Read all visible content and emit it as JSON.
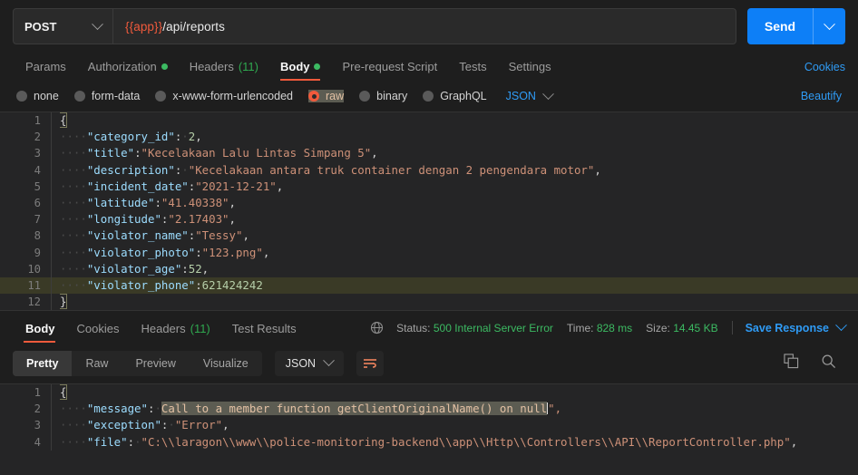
{
  "request": {
    "method": "POST",
    "method_icon": "chevron-down-icon",
    "url_variable": "{{app}}",
    "url_path": "/api/reports",
    "send_label": "Send",
    "send_caret_icon": "chevron-down-icon",
    "tabs": [
      {
        "label": "Params",
        "badge": "",
        "dot": false,
        "active": false
      },
      {
        "label": "Authorization",
        "badge": "",
        "dot": true,
        "active": false
      },
      {
        "label": "Headers",
        "badge": "(11)",
        "dot": false,
        "active": false
      },
      {
        "label": "Body",
        "badge": "",
        "dot": true,
        "active": true
      },
      {
        "label": "Pre-request Script",
        "badge": "",
        "dot": false,
        "active": false
      },
      {
        "label": "Tests",
        "badge": "",
        "dot": false,
        "active": false
      },
      {
        "label": "Settings",
        "badge": "",
        "dot": false,
        "active": false
      }
    ],
    "cookies_label": "Cookies",
    "body_types": [
      {
        "label": "none",
        "selected": false
      },
      {
        "label": "form-data",
        "selected": false
      },
      {
        "label": "x-www-form-urlencoded",
        "selected": false
      },
      {
        "label": "raw",
        "selected": true
      },
      {
        "label": "binary",
        "selected": false
      },
      {
        "label": "GraphQL",
        "selected": false
      }
    ],
    "format_selected": "JSON",
    "format_caret_icon": "chevron-down-icon",
    "beautify_label": "Beautify",
    "body_lines": [
      {
        "n": "1",
        "text": "{",
        "highlight": false
      },
      {
        "n": "2",
        "text": "    \"category_id\": 2,",
        "highlight": false
      },
      {
        "n": "3",
        "text": "    \"title\":\"Kecelakaan Lalu Lintas Simpang 5\",",
        "highlight": false
      },
      {
        "n": "4",
        "text": "    \"description\": \"Kecelakaan antara truk container dengan 2 pengendara motor\",",
        "highlight": false
      },
      {
        "n": "5",
        "text": "    \"incident_date\":\"2021-12-21\",",
        "highlight": false
      },
      {
        "n": "6",
        "text": "    \"latitude\":\"41.40338\",",
        "highlight": false
      },
      {
        "n": "7",
        "text": "    \"longitude\":\"2.17403\",",
        "highlight": false
      },
      {
        "n": "8",
        "text": "    \"violator_name\":\"Tessy\",",
        "highlight": false
      },
      {
        "n": "9",
        "text": "    \"violator_photo\":\"123.png\",",
        "highlight": false
      },
      {
        "n": "10",
        "text": "    \"violator_age\":52,",
        "highlight": false
      },
      {
        "n": "11",
        "text": "    \"violator_phone\":621424242",
        "highlight": true
      },
      {
        "n": "12",
        "text": "}",
        "highlight": false
      }
    ]
  },
  "response": {
    "tabs": [
      {
        "label": "Body",
        "badge": "",
        "active": true
      },
      {
        "label": "Cookies",
        "badge": "",
        "active": false
      },
      {
        "label": "Headers",
        "badge": "(11)",
        "active": false
      },
      {
        "label": "Test Results",
        "badge": "",
        "active": false
      }
    ],
    "globe_icon": "globe-icon",
    "status_label": "Status:",
    "status_value": "500 Internal Server Error",
    "time_label": "Time:",
    "time_value": "828 ms",
    "size_label": "Size:",
    "size_value": "14.45 KB",
    "save_response_label": "Save Response",
    "save_caret_icon": "chevron-down-icon",
    "view_modes": [
      {
        "label": "Pretty",
        "active": true
      },
      {
        "label": "Raw",
        "active": false
      },
      {
        "label": "Preview",
        "active": false
      },
      {
        "label": "Visualize",
        "active": false
      }
    ],
    "format_selected": "JSON",
    "format_caret_icon": "chevron-down-icon",
    "wrap_icon": "word-wrap-icon",
    "copy_icon": "copy-icon",
    "search_icon": "search-icon",
    "body_lines": [
      {
        "n": "1",
        "pre": "{",
        "sel": "",
        "post": ""
      },
      {
        "n": "2",
        "pre": "    \"message\": \"",
        "sel": "Call to a member function getClientOriginalName() on null",
        "post": "\","
      },
      {
        "n": "3",
        "pre": "    \"exception\": \"Error\",",
        "sel": "",
        "post": ""
      },
      {
        "n": "4",
        "pre": "    \"file\": \"C:\\\\laragon\\\\www\\\\police-monitoring-backend\\\\app\\\\Http\\\\Controllers\\\\API\\\\ReportController.php\",",
        "sel": "",
        "post": ""
      }
    ]
  },
  "colors": {
    "accent_orange": "#f05a3c",
    "link_blue": "#2f9bf5",
    "send_blue": "#0d7ff7",
    "green": "#3cba62",
    "bg": "#1e1e1e",
    "editor_bg": "#252526"
  }
}
